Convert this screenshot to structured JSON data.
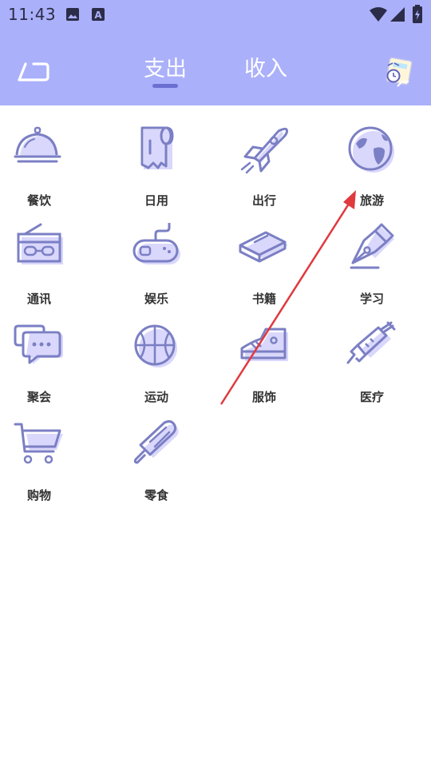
{
  "status_bar": {
    "time": "11:43",
    "icons": [
      "image-icon",
      "text-a-icon",
      "wifi-icon",
      "signal-icon",
      "battery-icon"
    ]
  },
  "header": {
    "tabs": [
      {
        "label": "支出",
        "active": true
      },
      {
        "label": "收入",
        "active": false
      }
    ],
    "back_icon": "return-arrow-icon",
    "calculator_icon": "calculator-icon"
  },
  "categories": [
    {
      "label": "餐饮",
      "icon": "food-cloche-icon"
    },
    {
      "label": "日用",
      "icon": "paper-roll-icon"
    },
    {
      "label": "出行",
      "icon": "rocket-icon"
    },
    {
      "label": "旅游",
      "icon": "globe-icon"
    },
    {
      "label": "通讯",
      "icon": "radio-icon"
    },
    {
      "label": "娱乐",
      "icon": "gamepad-icon"
    },
    {
      "label": "书籍",
      "icon": "book-icon"
    },
    {
      "label": "学习",
      "icon": "fountain-pen-icon"
    },
    {
      "label": "聚会",
      "icon": "chat-bubbles-icon"
    },
    {
      "label": "运动",
      "icon": "basketball-icon"
    },
    {
      "label": "服饰",
      "icon": "shoe-icon"
    },
    {
      "label": "医疗",
      "icon": "syringe-icon"
    },
    {
      "label": "购物",
      "icon": "shopping-cart-icon"
    },
    {
      "label": "零食",
      "icon": "popsicle-icon"
    }
  ],
  "colors": {
    "header": "#abb0fa",
    "icon_stroke": "#7b7fc4",
    "icon_fill": "#d9d7fb",
    "annotation_arrow": "#e0393e"
  }
}
